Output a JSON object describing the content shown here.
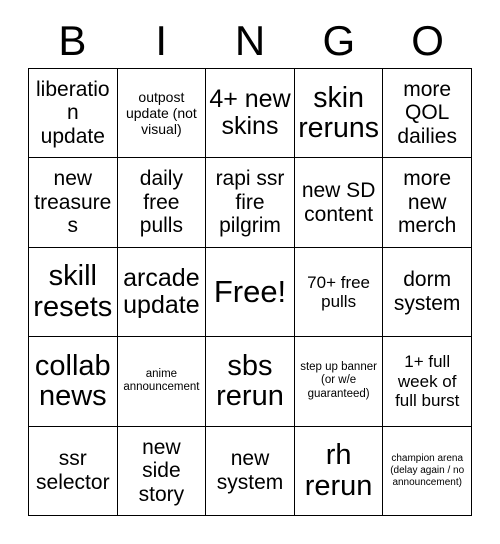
{
  "card": {
    "title_letters": [
      "B",
      "I",
      "N",
      "G",
      "O"
    ],
    "columns": 5,
    "rows": 5,
    "free_space_index": 12,
    "colors": {
      "background": "#ffffff",
      "text": "#000000",
      "grid_line": "#000000"
    },
    "cells": [
      {
        "text": "liberation update",
        "size": "m"
      },
      {
        "text": "outpost update (not visual)",
        "size": "xs"
      },
      {
        "text": "4+ new skins",
        "size": "l"
      },
      {
        "text": "skin reruns",
        "size": "xl"
      },
      {
        "text": "more QOL dailies",
        "size": "m"
      },
      {
        "text": "new treasures",
        "size": "m"
      },
      {
        "text": "daily free pulls",
        "size": "m"
      },
      {
        "text": "rapi ssr fire pilgrim",
        "size": "m"
      },
      {
        "text": "new SD content",
        "size": "m"
      },
      {
        "text": "more new merch",
        "size": "m"
      },
      {
        "text": "skill resets",
        "size": "xl"
      },
      {
        "text": "arcade update",
        "size": "l"
      },
      {
        "text": "Free!",
        "size": "xxl"
      },
      {
        "text": "70+ free pulls",
        "size": "s"
      },
      {
        "text": "dorm system",
        "size": "m"
      },
      {
        "text": "collab news",
        "size": "xl"
      },
      {
        "text": "anime announcement",
        "size": "xxs"
      },
      {
        "text": "sbs rerun",
        "size": "xl"
      },
      {
        "text": "step up banner (or w/e guaranteed)",
        "size": "xxs"
      },
      {
        "text": "1+ full week of full burst",
        "size": "s"
      },
      {
        "text": "ssr selector",
        "size": "m"
      },
      {
        "text": "new side story",
        "size": "m"
      },
      {
        "text": "new system",
        "size": "m"
      },
      {
        "text": "rh rerun",
        "size": "xl"
      },
      {
        "text": "champion arena (delay again / no announcement)",
        "size": "min"
      }
    ]
  }
}
